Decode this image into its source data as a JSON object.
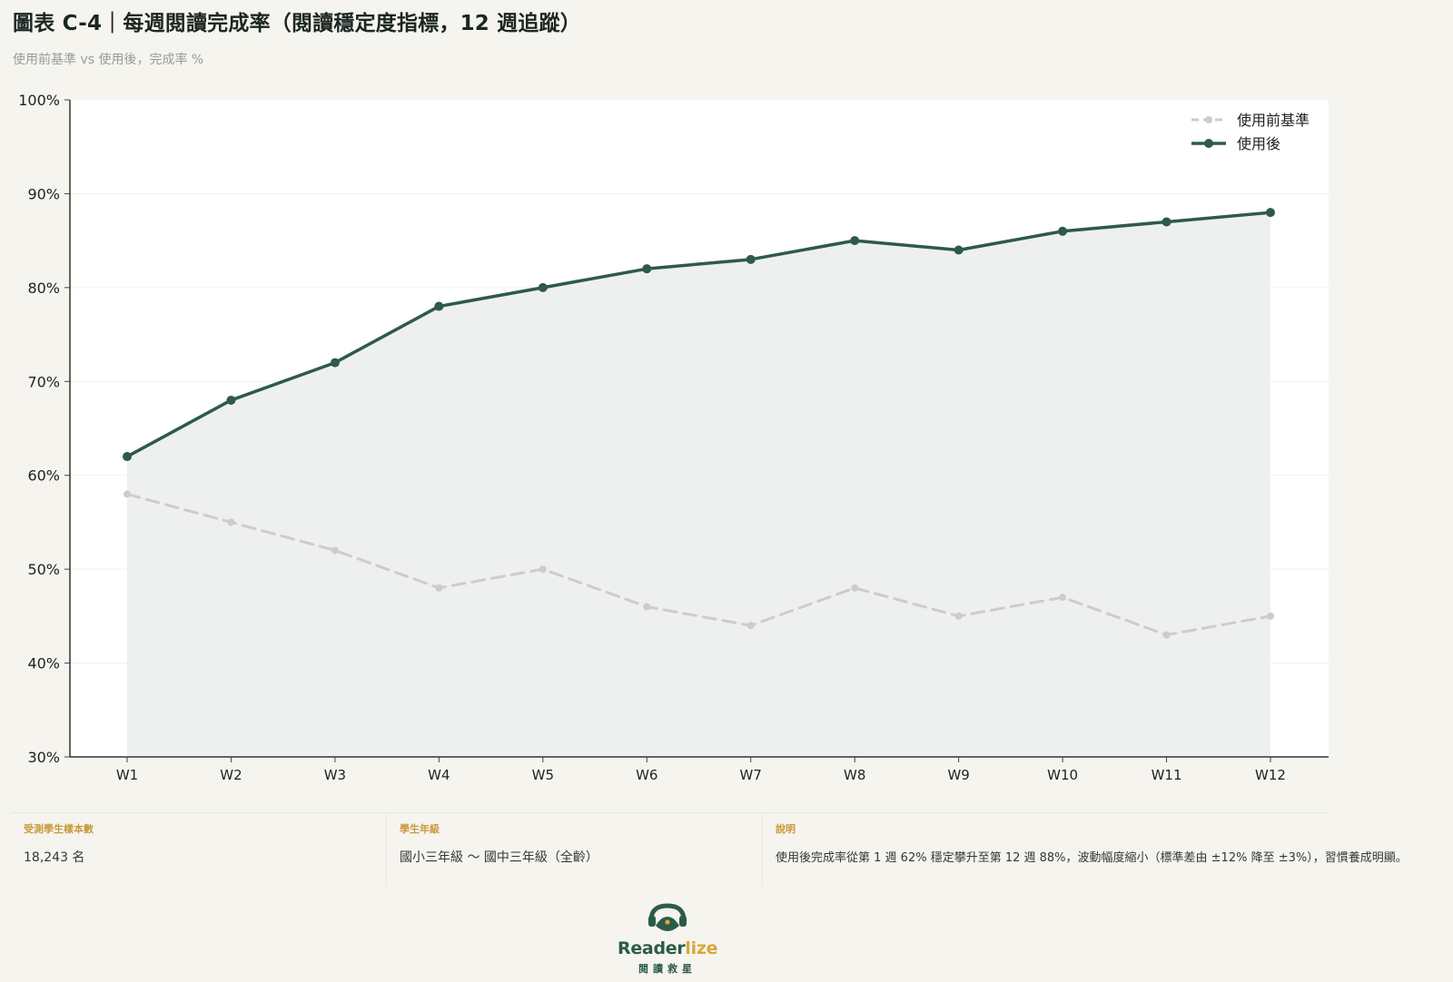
{
  "header": {
    "title": "圖表 C-4｜每週閱讀完成率（閱讀穩定度指標，12 週追蹤）",
    "subtitle": "使用前基準 vs 使用後，完成率 %"
  },
  "chart_data": {
    "type": "line",
    "title": "圖表 C-4｜每週閱讀完成率（閱讀穩定度指標，12 週追蹤）",
    "subtitle": "使用前基準 vs 使用後，完成率 %",
    "categories": [
      "W1",
      "W2",
      "W3",
      "W4",
      "W5",
      "W6",
      "W7",
      "W8",
      "W9",
      "W10",
      "W11",
      "W12"
    ],
    "series": [
      {
        "name": "使用前基準",
        "style": "dashed",
        "color": "#cccccc",
        "values": [
          58,
          55,
          52,
          48,
          50,
          46,
          44,
          48,
          45,
          47,
          43,
          45
        ]
      },
      {
        "name": "使用後",
        "style": "solid",
        "color": "#2d5a4a",
        "values": [
          62,
          68,
          72,
          78,
          80,
          82,
          83,
          85,
          84,
          86,
          87,
          88
        ]
      }
    ],
    "xlabel": "",
    "ylabel": "",
    "ylim": [
      30,
      100
    ],
    "yticks": [
      "30%",
      "40%",
      "50%",
      "60%",
      "70%",
      "80%",
      "90%",
      "100%"
    ],
    "grid": true,
    "legend_position": "top-right",
    "area_fill_under": "使用後",
    "colors": {
      "after": "#2d5a4a",
      "baseline": "#cccccc",
      "area": "#eef0ef",
      "plot_bg": "#ffffff"
    }
  },
  "info": [
    {
      "label": "受測學生樣本數",
      "value": "18,243 名"
    },
    {
      "label": "學生年級",
      "value": "國小三年級 ～ 國中三年級（全齡）"
    },
    {
      "label": "說明",
      "value": "使用後完成率從第 1 週 62% 穩定攀升至第 12 週 88%，波動幅度縮小（標準差由 ±12% 降至 ±3%），習慣養成明顯。"
    }
  ],
  "logo": {
    "word_main": "Reader",
    "word_accent": "lize",
    "subtitle": "閱讀救星",
    "colors": {
      "primary": "#2d5a4a",
      "accent": "#d8a73c"
    }
  }
}
